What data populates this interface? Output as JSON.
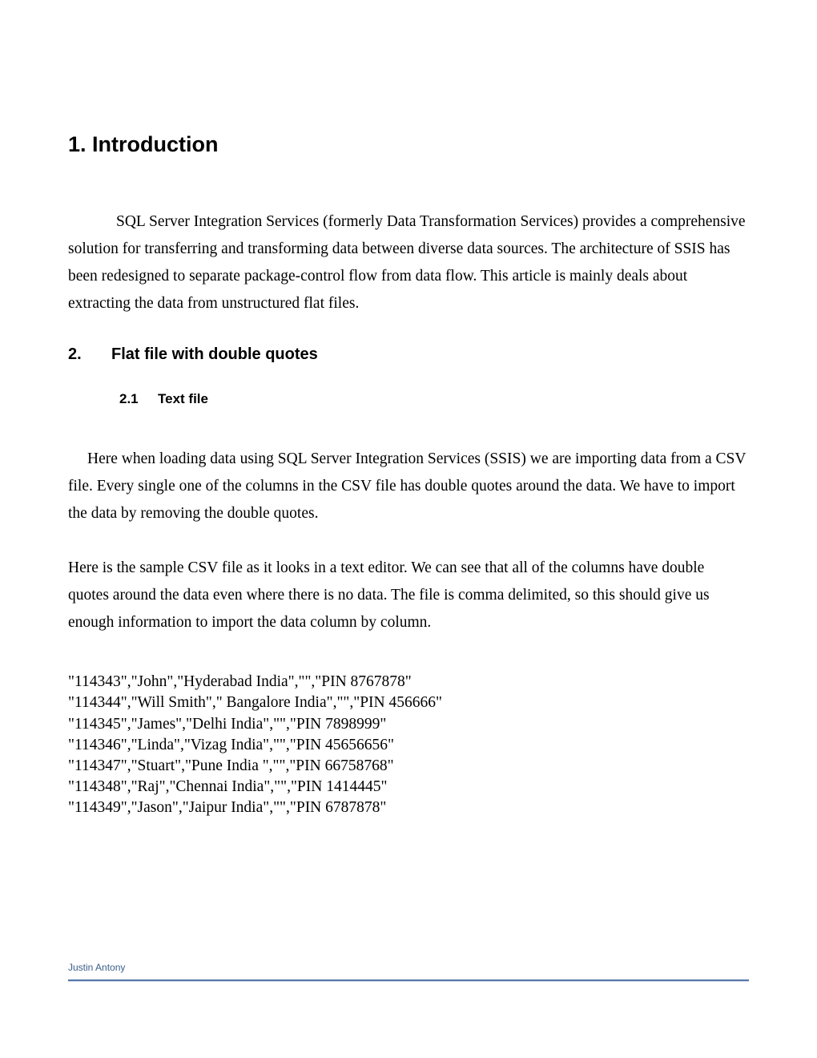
{
  "headings": {
    "h1": "1. Introduction",
    "h2_num": "2.",
    "h2_text": "Flat file with double quotes",
    "h3_num": "2.1",
    "h3_text": "Text file"
  },
  "paragraphs": {
    "intro": "SQL Server Integration Services (formerly Data Transformation Services) provides a comprehensive solution for transferring and transforming data between diverse data sources.  The architecture of SSIS has been redesigned to separate package-control flow from data flow. This article is mainly deals about extracting the data from unstructured flat files.",
    "p2": "Here when loading data using SQL Server Integration Services (SSIS) we are importing data from a CSV file.  Every single one of the columns in the CSV file has double quotes around the data.   We have to import the data by removing the double quotes.",
    "p3": "Here is the sample CSV file as it looks in a text editor.  We can see that all of the columns have double quotes around the data even where there is no data.  The file is comma delimited, so this should give us enough information to import the data column by column."
  },
  "csv_lines": [
    "\"114343\",\"John\",\"Hyderabad India\",\"\",\"PIN 8767878\"",
    "\"114344\",\"Will Smith\",\" Bangalore India\",\"\",\"PIN 456666\"",
    "\"114345\",\"James\",\"Delhi India\",\"\",\"PIN 7898999\"",
    "\"114346\",\"Linda\",\"Vizag India\",\"\",\"PIN 45656656\"",
    "\"114347\",\"Stuart\",\"Pune India \",\"\",\"PIN 66758768\"",
    "\"114348\",\"Raj\",\"Chennai India\",\"\",\"PIN 1414445\"",
    "\"114349\",\"Jason\",\"Jaipur India\",\"\",\"PIN 6787878\""
  ],
  "footer": {
    "author": "Justin Antony"
  }
}
